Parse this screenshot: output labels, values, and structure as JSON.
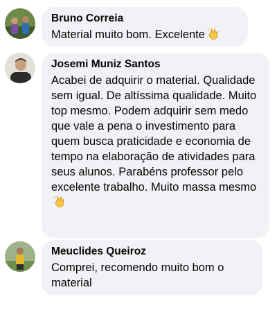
{
  "comments": [
    {
      "author": "Bruno Correia",
      "text": "Material muito bom. Excelente",
      "emoji_icon": "clapping-hands-icon"
    },
    {
      "author": "Josemi Muniz Santos",
      "text": "Acabei de adquirir o material. Qualidade sem igual. De altíssima qualidade. Muito top mesmo. Podem adquirir sem medo que vale a pena o investimento para quem busca praticidade e economia de tempo na elaboração de atividades para seus alunos. Parabéns professor pelo excelente trabalho. Muito massa mesmo",
      "emoji_icon": "clapping-hands-icon"
    },
    {
      "author": "Meuclides Queiroz",
      "text": "Comprei, recomendo muito bom o material"
    }
  ],
  "colors": {
    "bubble_background": "#f0f2f5",
    "text": "#050505",
    "clap_emoji": "#f7c948"
  }
}
